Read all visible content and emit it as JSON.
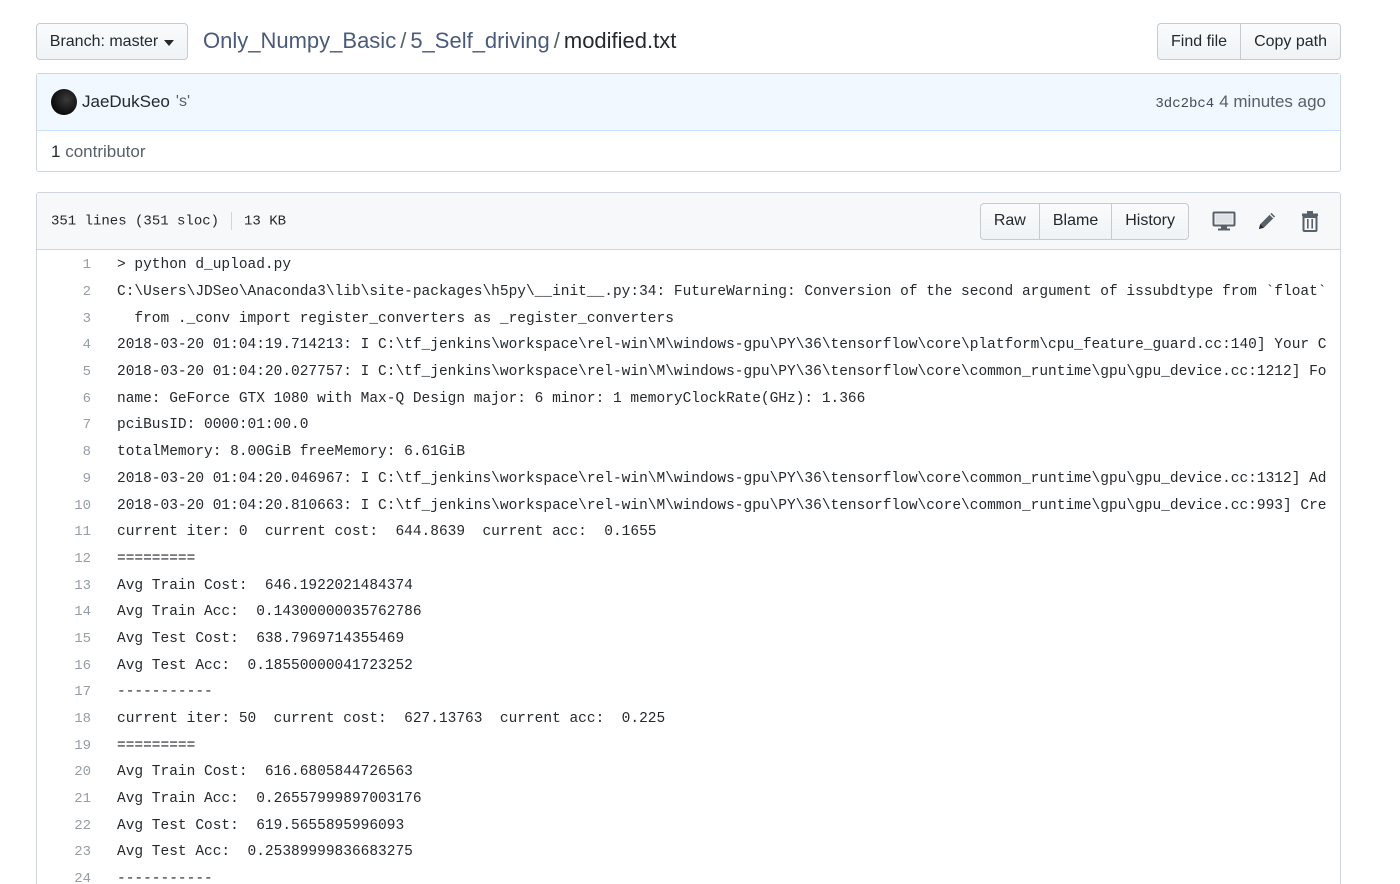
{
  "header": {
    "branch_label": "Branch: master",
    "breadcrumb": {
      "repo": "Only_Numpy_Basic",
      "folder": "5_Self_driving",
      "separator": "/",
      "file": "modified.txt"
    },
    "find_file_label": "Find file",
    "copy_path_label": "Copy path"
  },
  "commit": {
    "author": "JaeDukSeo",
    "message": "'s'",
    "sha": "3dc2bc4",
    "time": "4 minutes ago",
    "contributors_count": "1",
    "contributors_label": "contributor"
  },
  "file": {
    "lines_info": "351 lines (351 sloc)",
    "size": "13 KB",
    "raw_label": "Raw",
    "blame_label": "Blame",
    "history_label": "History",
    "icons": [
      "desktop-icon",
      "pencil-icon",
      "trash-icon"
    ]
  },
  "code_lines": [
    {
      "n": "1",
      "text": "> python d_upload.py"
    },
    {
      "n": "2",
      "text": "C:\\Users\\JDSeo\\Anaconda3\\lib\\site-packages\\h5py\\__init__.py:34: FutureWarning: Conversion of the second argument of issubdtype from `float`"
    },
    {
      "n": "3",
      "text": "  from ._conv import register_converters as _register_converters"
    },
    {
      "n": "4",
      "text": "2018-03-20 01:04:19.714213: I C:\\tf_jenkins\\workspace\\rel-win\\M\\windows-gpu\\PY\\36\\tensorflow\\core\\platform\\cpu_feature_guard.cc:140] Your C"
    },
    {
      "n": "5",
      "text": "2018-03-20 01:04:20.027757: I C:\\tf_jenkins\\workspace\\rel-win\\M\\windows-gpu\\PY\\36\\tensorflow\\core\\common_runtime\\gpu\\gpu_device.cc:1212] Fo"
    },
    {
      "n": "6",
      "text": "name: GeForce GTX 1080 with Max-Q Design major: 6 minor: 1 memoryClockRate(GHz): 1.366"
    },
    {
      "n": "7",
      "text": "pciBusID: 0000:01:00.0"
    },
    {
      "n": "8",
      "text": "totalMemory: 8.00GiB freeMemory: 6.61GiB"
    },
    {
      "n": "9",
      "text": "2018-03-20 01:04:20.046967: I C:\\tf_jenkins\\workspace\\rel-win\\M\\windows-gpu\\PY\\36\\tensorflow\\core\\common_runtime\\gpu\\gpu_device.cc:1312] Ad"
    },
    {
      "n": "10",
      "text": "2018-03-20 01:04:20.810663: I C:\\tf_jenkins\\workspace\\rel-win\\M\\windows-gpu\\PY\\36\\tensorflow\\core\\common_runtime\\gpu\\gpu_device.cc:993] Cre"
    },
    {
      "n": "11",
      "text": "current iter: 0  current cost:  644.8639  current acc:  0.1655"
    },
    {
      "n": "12",
      "text": "========="
    },
    {
      "n": "13",
      "text": "Avg Train Cost:  646.1922021484374"
    },
    {
      "n": "14",
      "text": "Avg Train Acc:  0.14300000035762786"
    },
    {
      "n": "15",
      "text": "Avg Test Cost:  638.7969714355469"
    },
    {
      "n": "16",
      "text": "Avg Test Acc:  0.18550000041723252"
    },
    {
      "n": "17",
      "text": "-----------"
    },
    {
      "n": "18",
      "text": "current iter: 50  current cost:  627.13763  current acc:  0.225"
    },
    {
      "n": "19",
      "text": "========="
    },
    {
      "n": "20",
      "text": "Avg Train Cost:  616.6805844726563"
    },
    {
      "n": "21",
      "text": "Avg Train Acc:  0.26557999897003176"
    },
    {
      "n": "22",
      "text": "Avg Test Cost:  619.5655895996093"
    },
    {
      "n": "23",
      "text": "Avg Test Acc:  0.25389999836683275"
    },
    {
      "n": "24",
      "text": "-----------"
    }
  ]
}
